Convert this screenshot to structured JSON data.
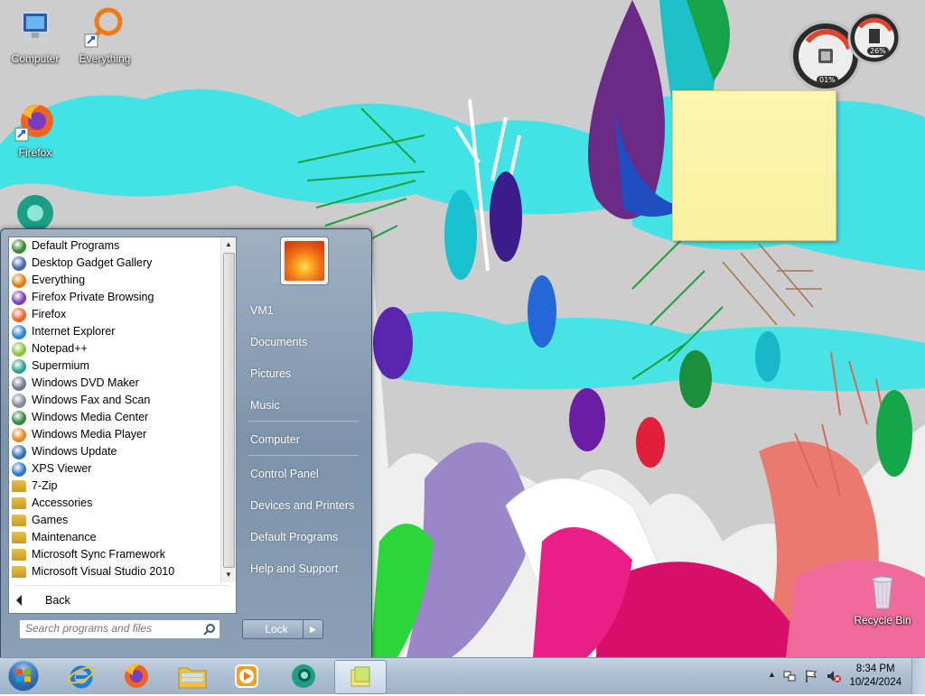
{
  "desktop": {
    "icons": [
      {
        "label": "Computer"
      },
      {
        "label": "Everything"
      },
      {
        "label": "Firefox"
      },
      {
        "label": "Recycle Bin"
      }
    ],
    "gadget": {
      "cpu": "01%",
      "memory": "26%"
    }
  },
  "start_menu": {
    "programs": [
      {
        "label": "Default Programs",
        "icon": "default-programs-icon",
        "color": "#3a8a2c"
      },
      {
        "label": "Desktop Gadget Gallery",
        "icon": "gadget-gallery-icon",
        "color": "#4466aa"
      },
      {
        "label": "Everything",
        "icon": "everything-icon",
        "color": "#e07a10"
      },
      {
        "label": "Firefox Private Browsing",
        "icon": "firefox-private-icon",
        "color": "#7b3fb8"
      },
      {
        "label": "Firefox",
        "icon": "firefox-icon",
        "color": "#f2631e"
      },
      {
        "label": "Internet Explorer",
        "icon": "internet-explorer-icon",
        "color": "#2a86d6"
      },
      {
        "label": "Notepad++",
        "icon": "notepad-plus-plus-icon",
        "color": "#8fc33a"
      },
      {
        "label": "Supermium",
        "icon": "supermium-icon",
        "color": "#2aa38a"
      },
      {
        "label": "Windows DVD Maker",
        "icon": "dvd-maker-icon",
        "color": "#6b7b8c"
      },
      {
        "label": "Windows Fax and Scan",
        "icon": "fax-scan-icon",
        "color": "#7f8c99"
      },
      {
        "label": "Windows Media Center",
        "icon": "media-center-icon",
        "color": "#2d8a3a"
      },
      {
        "label": "Windows Media Player",
        "icon": "media-player-icon",
        "color": "#e58a1f"
      },
      {
        "label": "Windows Update",
        "icon": "windows-update-icon",
        "color": "#2d6fbf"
      },
      {
        "label": "XPS Viewer",
        "icon": "xps-viewer-icon",
        "color": "#2a78c8"
      },
      {
        "label": "7-Zip",
        "icon": "folder-icon",
        "color": "#e8c04a"
      },
      {
        "label": "Accessories",
        "icon": "folder-icon",
        "color": "#e8c04a"
      },
      {
        "label": "Games",
        "icon": "folder-icon",
        "color": "#e8c04a"
      },
      {
        "label": "Maintenance",
        "icon": "folder-icon",
        "color": "#e8c04a"
      },
      {
        "label": "Microsoft Sync Framework",
        "icon": "folder-icon",
        "color": "#e8c04a"
      },
      {
        "label": "Microsoft Visual Studio 2010",
        "icon": "folder-icon",
        "color": "#e8c04a"
      }
    ],
    "back_label": "Back",
    "search_placeholder": "Search programs and files",
    "right_items": [
      {
        "label": "VM1"
      },
      {
        "label": "Documents"
      },
      {
        "label": "Pictures"
      },
      {
        "label": "Music"
      },
      {
        "label": "Computer"
      },
      {
        "label": "Control Panel"
      },
      {
        "label": "Devices and Printers"
      },
      {
        "label": "Default Programs"
      },
      {
        "label": "Help and Support"
      }
    ],
    "lock_label": "Lock"
  },
  "taskbar": {
    "pinned": [
      {
        "name": "internet-explorer"
      },
      {
        "name": "firefox"
      },
      {
        "name": "file-explorer"
      },
      {
        "name": "media-player"
      },
      {
        "name": "supermium"
      },
      {
        "name": "sticky-notes",
        "active": true
      }
    ],
    "clock": {
      "time": "8:34 PM",
      "date": "10/24/2024"
    }
  }
}
